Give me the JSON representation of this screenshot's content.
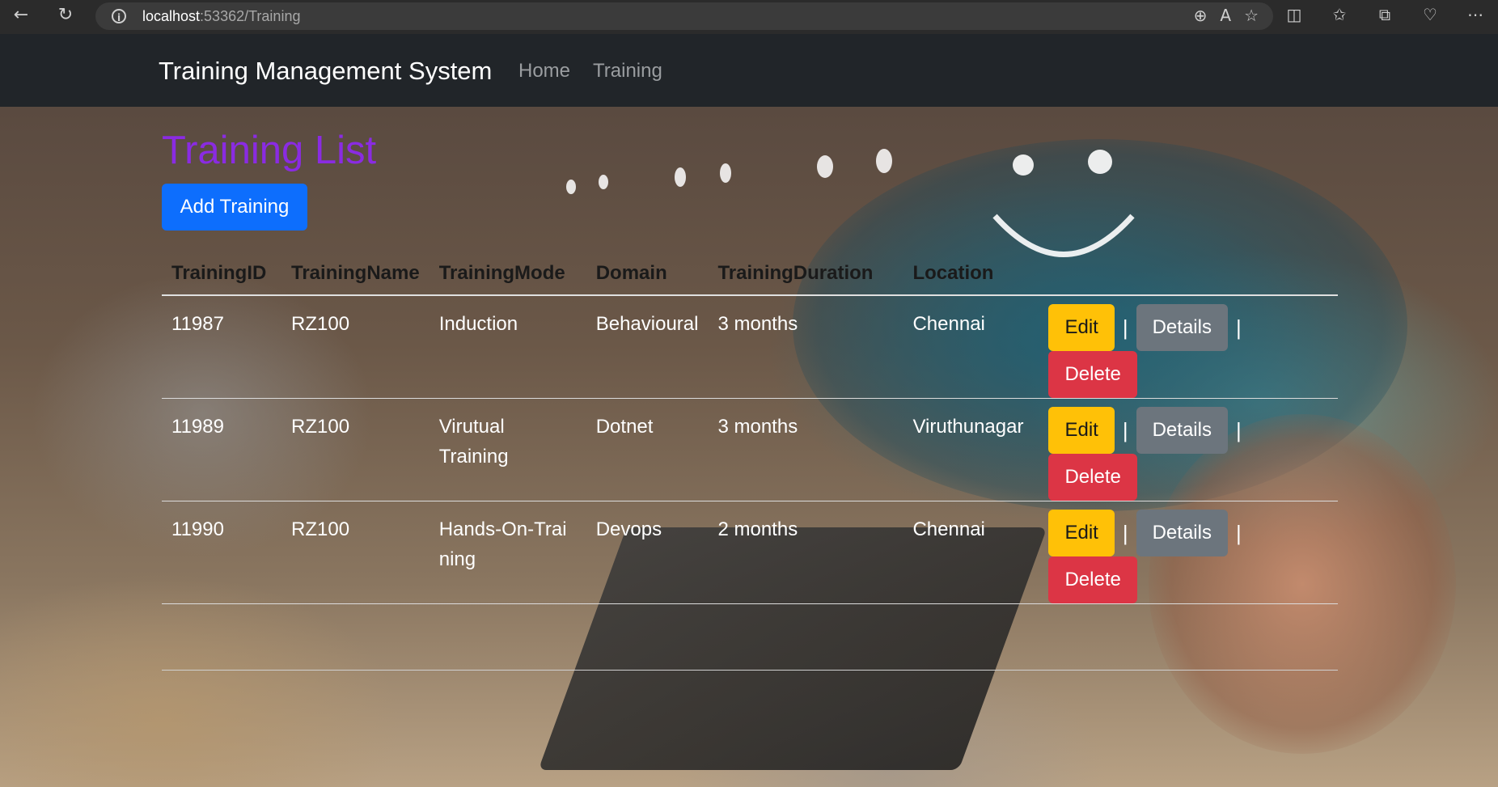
{
  "browser": {
    "url_host": "localhost",
    "url_path": ":53362/Training"
  },
  "nav": {
    "brand": "Training Management System",
    "links": [
      "Home",
      "Training"
    ]
  },
  "page": {
    "title": "Training List",
    "add_button": "Add Training"
  },
  "table": {
    "columns": [
      "TrainingID",
      "TrainingName",
      "TrainingMode",
      "Domain",
      "TrainingDuration",
      "Location"
    ],
    "rows": [
      {
        "id": "11987",
        "name": "RZ100",
        "mode": "Induction",
        "domain": "Behavioural",
        "duration": "3 months",
        "location": "Chennai"
      },
      {
        "id": "11989",
        "name": "RZ100",
        "mode": "Virutual Training",
        "domain": "Dotnet",
        "duration": "3 months",
        "location": "Viruthunagar"
      },
      {
        "id": "11990",
        "name": "RZ100",
        "mode": "Hands-On-Training",
        "domain": "Devops",
        "duration": "2 months",
        "location": "Chennai"
      }
    ],
    "actions": {
      "edit": "Edit",
      "details": "Details",
      "delete": "Delete",
      "separator": "|"
    }
  },
  "colors": {
    "title": "#8a2be2",
    "primary": "#0d6efd",
    "warning": "#ffc107",
    "secondary": "#6c757d",
    "danger": "#dc3545",
    "navbar": "#212529"
  }
}
